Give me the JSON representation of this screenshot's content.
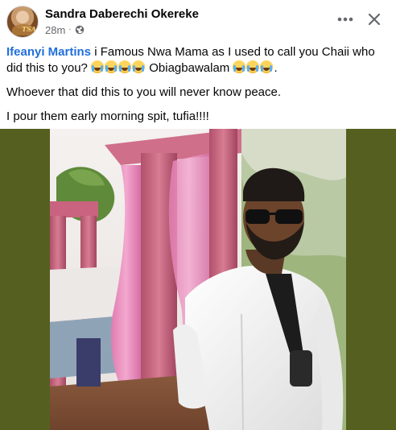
{
  "post": {
    "author": "Sandra Daberechi Okereke",
    "avatar_tag": "TSA",
    "time": "28m",
    "separator": "·",
    "audience_icon": "globe-icon",
    "actions": {
      "more_icon": "more-horizontal-icon",
      "close_icon": "close-icon"
    },
    "mention": "Ifeanyi Martins",
    "text_line1_a": " i Famous Nwa Mama as I used to call you Chaii who did this to you? ",
    "emojis_group1_count": 4,
    "text_line1_b": " Obiagbawalam ",
    "emojis_group2_count": 3,
    "text_line1_end": ".",
    "paragraph2": "Whoever that did this to you will never know peace.",
    "paragraph3": "I pour them early morning spit, tufia!!!!",
    "photo_description_alt": ""
  },
  "colors": {
    "mention": "#216fdb",
    "text": "#050505",
    "secondary": "#65676b",
    "photo_letterbox": "#556020"
  }
}
